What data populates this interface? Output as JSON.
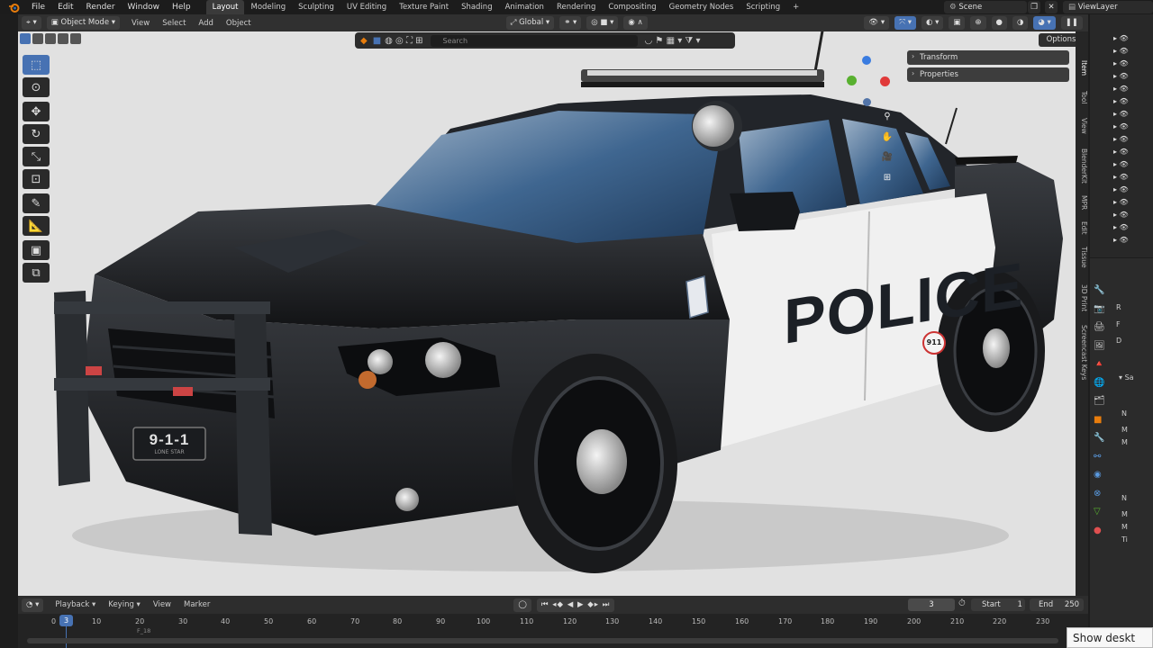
{
  "menu": {
    "items": [
      "File",
      "Edit",
      "Render",
      "Window",
      "Help"
    ],
    "workspaces": [
      "Layout",
      "Modeling",
      "Sculpting",
      "UV Editing",
      "Texture Paint",
      "Shading",
      "Animation",
      "Rendering",
      "Compositing",
      "Geometry Nodes",
      "Scripting"
    ],
    "active_workspace": "Layout",
    "add_tab": "+",
    "scene": "Scene",
    "view_layer": "ViewLayer"
  },
  "viewport_header": {
    "mode": "Object Mode",
    "menus": [
      "View",
      "Select",
      "Add",
      "Object"
    ],
    "orientation": "Global",
    "options": "Options"
  },
  "search": {
    "placeholder": "Search"
  },
  "npanel": {
    "transform": "Transform",
    "properties": "Properties",
    "tabs": [
      "Item",
      "Tool",
      "View",
      "BlenderKit",
      "MPR",
      "Edit",
      "Tissue",
      "3D Print",
      "Screencast Keys"
    ]
  },
  "scene": {
    "livery_text": "POLICE",
    "badge_text": "911",
    "plate_text": "9-1-1",
    "plate_sub": "LONE STAR",
    "colors": {
      "body_black": "#1b1d20",
      "door_white": "#f2f2f2",
      "background": "#e1e1e1",
      "glass": "#3a5f8a"
    }
  },
  "props": {
    "labels": [
      "R",
      "F",
      "D",
      "N",
      "M",
      "M",
      "N",
      "M",
      "M",
      "Ti"
    ],
    "section": "Sa"
  },
  "timeline": {
    "menus": [
      "Playback",
      "Keying",
      "View",
      "Marker"
    ],
    "current_frame": "3",
    "start_label": "Start",
    "start": "1",
    "end_label": "End",
    "end": "250",
    "ticks": [
      "0",
      "10",
      "20",
      "30",
      "40",
      "50",
      "60",
      "70",
      "80",
      "90",
      "100",
      "110",
      "120",
      "130",
      "140",
      "150",
      "160",
      "170",
      "180",
      "190",
      "200",
      "210",
      "220",
      "230"
    ],
    "marker": "F_18"
  },
  "taskbar_tooltip": "Show deskt"
}
